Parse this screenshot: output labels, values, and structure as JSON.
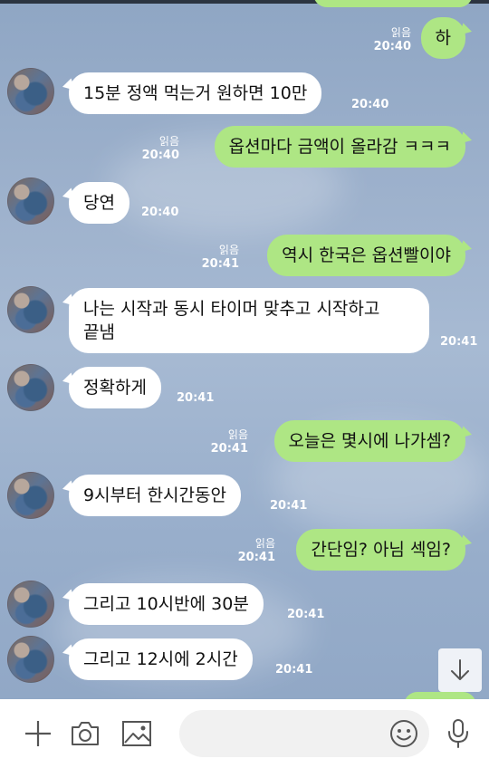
{
  "messages": [
    {
      "side": "out",
      "text": "하",
      "read": "읽음",
      "time": "20:40"
    },
    {
      "side": "in",
      "text": "15분 정액 먹는거 원하면 10만",
      "time": "20:40"
    },
    {
      "side": "out",
      "text": "옵션마다 금액이 올라감 ㅋㅋㅋ",
      "read": "읽음",
      "time": "20:40"
    },
    {
      "side": "in",
      "text": "당연",
      "time": "20:40"
    },
    {
      "side": "out",
      "text": "역시 한국은 옵션빨이야",
      "read": "읽음",
      "time": "20:41"
    },
    {
      "side": "in",
      "text": "나는 시작과 동시 타이머 맞추고 시작하고",
      "text2": "끝냄",
      "time": "20:41"
    },
    {
      "side": "in",
      "text": "정확하게",
      "time": "20:41"
    },
    {
      "side": "out",
      "text": "오늘은 몇시에 나가셈?",
      "read": "읽음",
      "time": "20:41"
    },
    {
      "side": "in",
      "text": "9시부터 한시간동안",
      "time": "20:41"
    },
    {
      "side": "out",
      "text": "간단임? 아님 섹임?",
      "read": "읽음",
      "time": "20:41"
    },
    {
      "side": "in",
      "text": "그리고 10시반에 30분",
      "time": "20:41"
    },
    {
      "side": "in",
      "text": "그리고 12시에 2시간",
      "time": "20:41"
    }
  ],
  "input": {
    "placeholder": "",
    "value": ""
  },
  "icons": {
    "add": "plus-icon",
    "camera": "camera-icon",
    "gallery": "image-icon",
    "emoji": "emoji-icon",
    "mic": "microphone-icon",
    "scroll": "arrow-down-icon"
  },
  "colors": {
    "outgoing": "#aee684",
    "incoming": "#ffffff",
    "background": "#9db1cc"
  }
}
